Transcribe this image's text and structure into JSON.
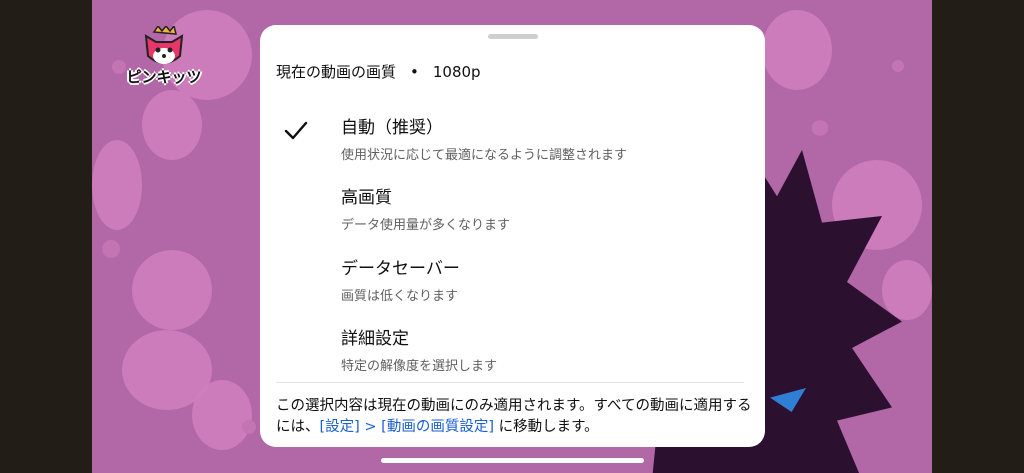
{
  "video": {
    "logo_text": "ピンキッツ"
  },
  "quality_sheet": {
    "header_label": "現在の動画の画質",
    "header_separator": "•",
    "current_quality": "1080p",
    "options": [
      {
        "title": "自動（推奨）",
        "description": "使用状況に応じて最適になるように調整されます",
        "selected": true
      },
      {
        "title": "高画質",
        "description": "データ使用量が多くなります",
        "selected": false
      },
      {
        "title": "データセーバー",
        "description": "画質は低くなります",
        "selected": false
      },
      {
        "title": "詳細設定",
        "description": "特定の解像度を選択します",
        "selected": false
      }
    ],
    "note_prefix": "この選択内容は現在の動画にのみ適用されます。すべての動画に適用するには、",
    "note_link": "[設定] > [動画の画質設定]",
    "note_suffix": " に移動します。"
  },
  "colors": {
    "link": "#1a5fd0",
    "video_background": "#b267a7"
  }
}
